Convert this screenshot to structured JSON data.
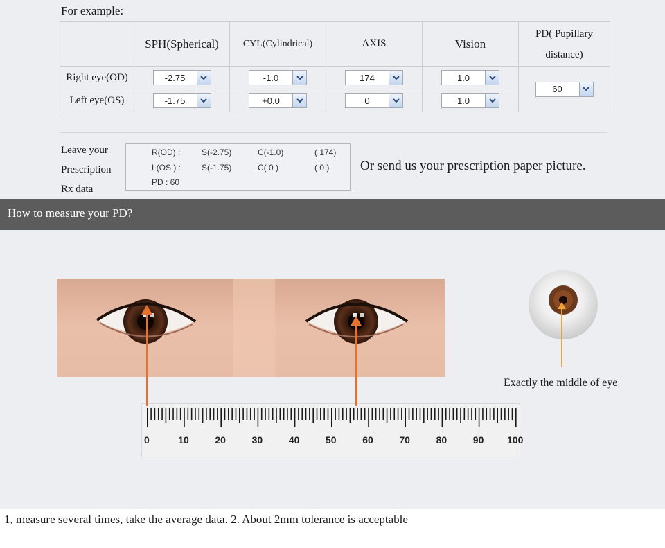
{
  "example": {
    "heading": "For example:",
    "columns": [
      "SPH(Spherical)",
      "CYL(Cylindrical)",
      "AXIS",
      "Vision"
    ],
    "pd_header_line1": "PD( Pupillary",
    "pd_header_line2": "distance)",
    "rows": [
      {
        "label": "Right eye(OD)",
        "sph": "-2.75",
        "cyl": "-1.0",
        "axis": "174",
        "vision": "1.0"
      },
      {
        "label": "Left eye(OS)",
        "sph": "-1.75",
        "cyl": "+0.0",
        "axis": "0",
        "vision": "1.0"
      }
    ],
    "pd_value": "60"
  },
  "prescription": {
    "label_lines": [
      "Leave your",
      "Prescription",
      "Rx data"
    ],
    "od_label": "R(OD) :",
    "od_s": "S(-2.75)",
    "od_c": "C(-1.0)",
    "od_axis": "( 174)",
    "os_label": "L(OS ) :",
    "os_s": "S(-1.75)",
    "os_c": "C( 0 )",
    "os_axis": "( 0 )",
    "pd": "PD : 60",
    "send_text": "Or send us your prescription paper picture."
  },
  "measure": {
    "title": "How to measure your PD?",
    "ruler_labels": [
      "0",
      "10",
      "20",
      "30",
      "40",
      "50",
      "60",
      "70",
      "80",
      "90",
      "100"
    ],
    "middle_caption": "Exactly the middle of eye",
    "footer": "1, measure several times, take the average data.  2. About 2mm tolerance is acceptable"
  },
  "colors": {
    "pointer": "#e5732e",
    "iris": "#5a2f1b",
    "header_bar": "#5c5c5c"
  }
}
